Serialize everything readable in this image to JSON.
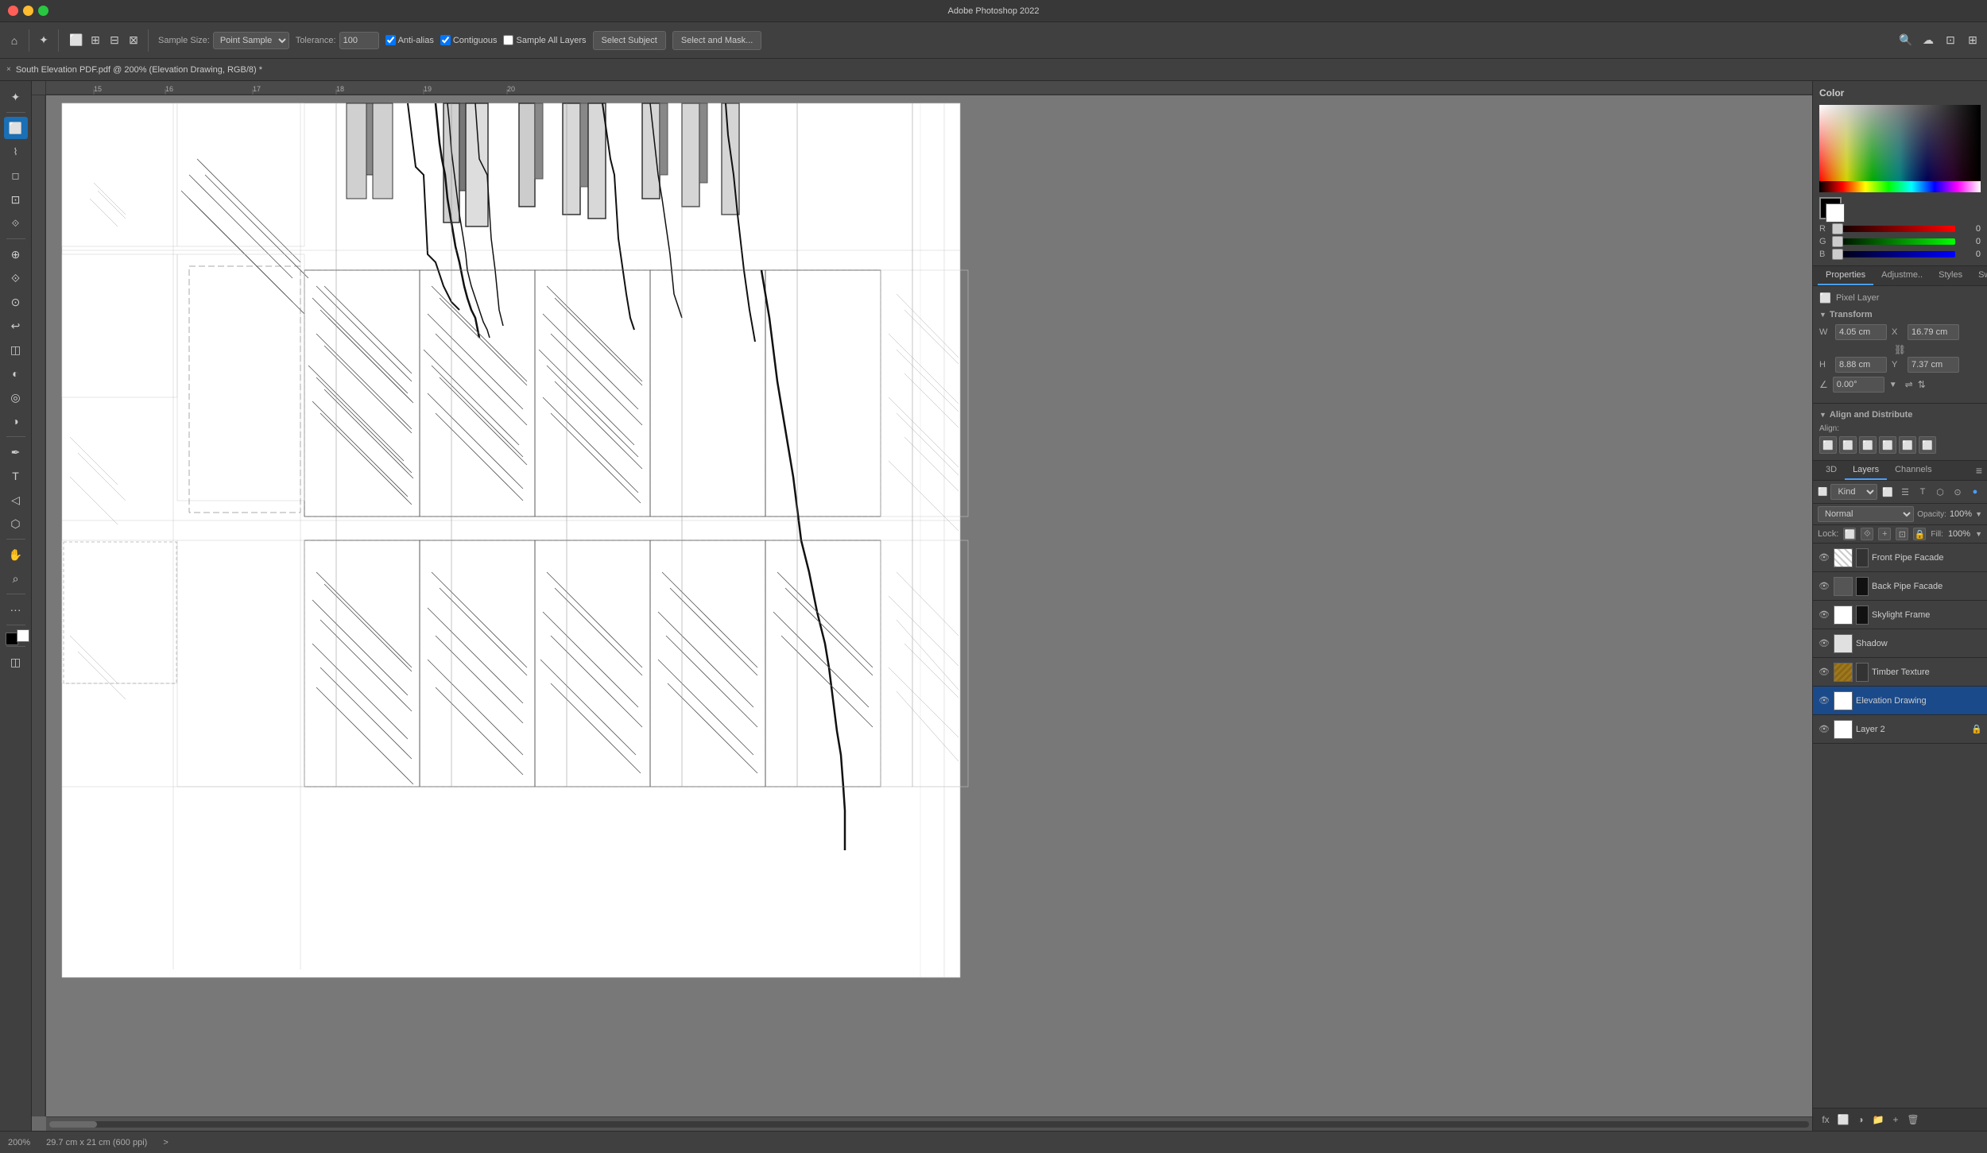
{
  "app": {
    "title": "Adobe Photoshop 2022",
    "window_title": "South Elevation PDF.pdf @ 200% (Elevation Drawing, RGB/8) *"
  },
  "traffic_lights": {
    "close": "×",
    "minimize": "–",
    "maximize": "+"
  },
  "toolbar": {
    "sample_size_label": "Sample Size:",
    "sample_size_value": "Point Sample",
    "tolerance_label": "Tolerance:",
    "tolerance_value": "100",
    "anti_alias_label": "Anti-alias",
    "contiguous_label": "Contiguous",
    "sample_all_layers_label": "Sample All Layers",
    "select_subject_label": "Select Subject",
    "select_mask_label": "Select and Mask..."
  },
  "tab": {
    "close": "×",
    "title": "South Elevation PDF.pdf @ 200% (Elevation Drawing, RGB/8) *"
  },
  "statusbar": {
    "zoom": "200%",
    "dimensions": "29.7 cm x 21 cm (600 ppi)",
    "arrow": ">"
  },
  "color_panel": {
    "title": "Color",
    "r_label": "R",
    "g_label": "G",
    "b_label": "B",
    "r_value": "0",
    "g_value": "0",
    "b_value": "0"
  },
  "panel_tabs": {
    "properties_label": "Properties",
    "adjustments_label": "Adjustme..",
    "styles_label": "Styles",
    "swatches_label": "Swatches"
  },
  "properties": {
    "pixel_layer_label": "Pixel Layer",
    "transform_label": "Transform",
    "w_label": "W",
    "h_label": "H",
    "x_label": "X",
    "y_label": "Y",
    "w_value": "4.05 cm",
    "h_value": "8.88 cm",
    "x_value": "16.79 cm",
    "y_value": "7.37 cm",
    "angle_value": "0.00°",
    "align_label": "Align and Distribute",
    "align_sublabel": "Align:"
  },
  "layers_panel": {
    "layers_tab": "Layers",
    "channels_tab": "Channels",
    "3d_tab": "3D",
    "kind_placeholder": "Kind",
    "blend_mode": "Normal",
    "opacity_label": "Opacity:",
    "opacity_value": "100%",
    "lock_label": "Lock:",
    "fill_label": "Fill:",
    "fill_value": "100%",
    "layers": [
      {
        "name": "Front Pipe Facade",
        "visible": true,
        "thumb_type": "pattern",
        "locked": false
      },
      {
        "name": "Back Pipe Facade",
        "visible": true,
        "thumb_type": "dark",
        "locked": false
      },
      {
        "name": "Skylight Frame",
        "visible": true,
        "thumb_type": "white",
        "locked": false
      },
      {
        "name": "Shadow",
        "visible": true,
        "thumb_type": "white",
        "locked": false
      },
      {
        "name": "Timber Texture",
        "visible": true,
        "thumb_type": "texture",
        "locked": false
      },
      {
        "name": "Elevation Drawing",
        "visible": true,
        "thumb_type": "white",
        "locked": false,
        "active": true
      },
      {
        "name": "Layer 2",
        "visible": true,
        "thumb_type": "white",
        "locked": true
      }
    ]
  },
  "icons": {
    "eye": "👁",
    "lock": "🔒",
    "search": "🔍",
    "arrow_down": "▼",
    "arrow_right": "▶",
    "link": "🔗",
    "chain": "⛓",
    "add": "+",
    "delete": "🗑",
    "fx": "fx",
    "mask": "⬜",
    "group": "📁",
    "type": "T",
    "pixel": "⬜",
    "move": "✦",
    "select": "◻",
    "lasso": "⌇",
    "crop": "⊡",
    "heal": "⊕",
    "brush": "⟐",
    "stamp": "⊙",
    "eraser": "◫",
    "blur": "◎",
    "dodge": "◑",
    "pen": "✒",
    "text": "T",
    "shape": "⬡",
    "gradient": "◐",
    "bucket": "◫",
    "zoom_tool": "⌕",
    "hand": "✋",
    "eyedropper": "⟐",
    "foreground": "■",
    "background": "□"
  }
}
